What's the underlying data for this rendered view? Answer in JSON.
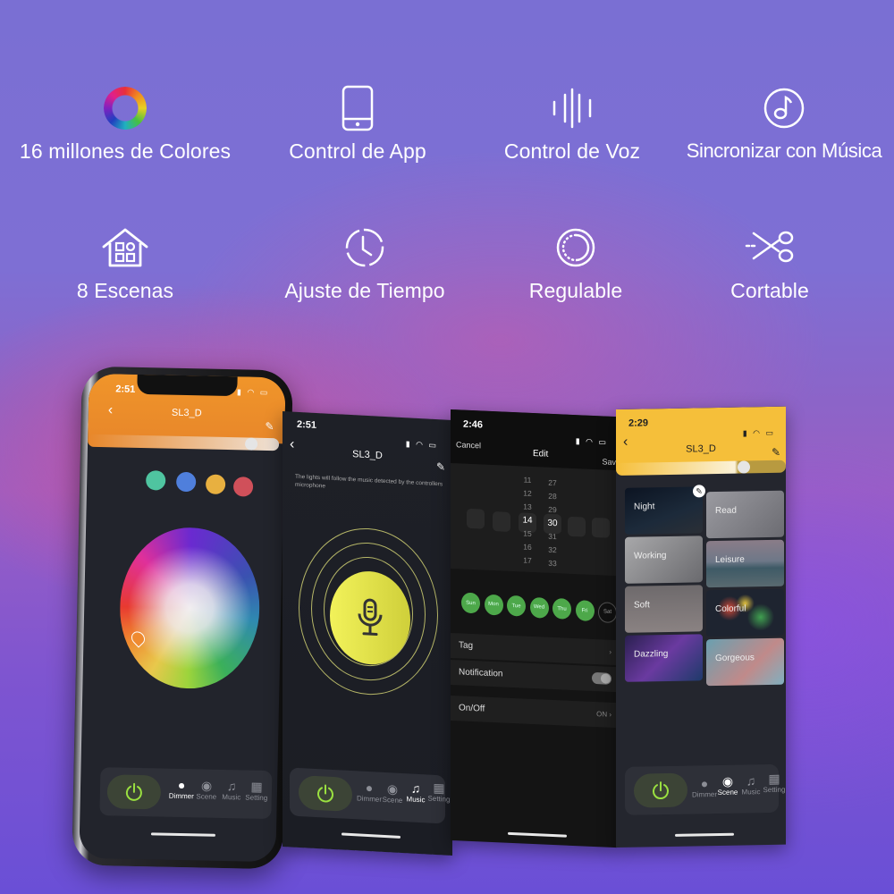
{
  "features": [
    {
      "icon": "color-ring-icon",
      "label": "16 millones de Colores"
    },
    {
      "icon": "smartphone-icon",
      "label": "Control de App"
    },
    {
      "icon": "voice-wave-icon",
      "label": "Control de Voz"
    },
    {
      "icon": "music-note-icon",
      "label": "Sincronizar con Música"
    },
    {
      "icon": "home-scenes-icon",
      "label": "8 Escenas"
    },
    {
      "icon": "clock-icon",
      "label": "Ajuste de Tiempo"
    },
    {
      "icon": "dimmer-icon",
      "label": "Regulable"
    },
    {
      "icon": "scissors-icon",
      "label": "Cortable"
    }
  ],
  "phones": {
    "dimmer": {
      "time": "2:51",
      "title": "SL3_D",
      "header_color": "#f0952a",
      "brightness_percent": 92,
      "preset_colors": [
        "#4fc4a0",
        "#4f7fdc",
        "#e8b040",
        "#d0505a"
      ],
      "tabs": [
        "Dimmer",
        "Scene",
        "Music",
        "Setting"
      ],
      "active_tab": "Dimmer"
    },
    "music": {
      "time": "2:51",
      "title": "SL3_D",
      "description": "The lights will follow the music detected by the controllers microphone",
      "tabs": [
        "Dimmer",
        "Scene",
        "Music",
        "Setting"
      ],
      "active_tab": "Music"
    },
    "schedule": {
      "time": "2:46",
      "cancel_label": "Cancel",
      "title": "Edit",
      "save_label": "Save",
      "hour_column": [
        "11",
        "12",
        "13",
        "14",
        "15",
        "16",
        "17"
      ],
      "minute_column": [
        "27",
        "28",
        "29",
        "30",
        "31",
        "32",
        "33"
      ],
      "selected_hour": "14",
      "selected_minute": "30",
      "days": [
        {
          "label": "Sun",
          "on": true
        },
        {
          "label": "Mon",
          "on": true
        },
        {
          "label": "Tue",
          "on": true
        },
        {
          "label": "Wed",
          "on": true
        },
        {
          "label": "Thu",
          "on": true
        },
        {
          "label": "Fri",
          "on": true
        },
        {
          "label": "Sat",
          "on": false
        }
      ],
      "tag_label": "Tag",
      "notification_label": "Notification",
      "notification_on": false,
      "onoff_label": "On/Off",
      "onoff_value": "ON"
    },
    "scenes": {
      "time": "2:29",
      "title": "SL3_D",
      "header_color": "#f5bf3a",
      "brightness_percent": 75,
      "scenes": [
        "Night",
        "Read",
        "Working",
        "Leisure",
        "Soft",
        "Colorful",
        "Dazzling",
        "Gorgeous"
      ],
      "tabs": [
        "Dimmer",
        "Scene",
        "Music",
        "Setting"
      ],
      "active_tab": "Scene"
    }
  }
}
